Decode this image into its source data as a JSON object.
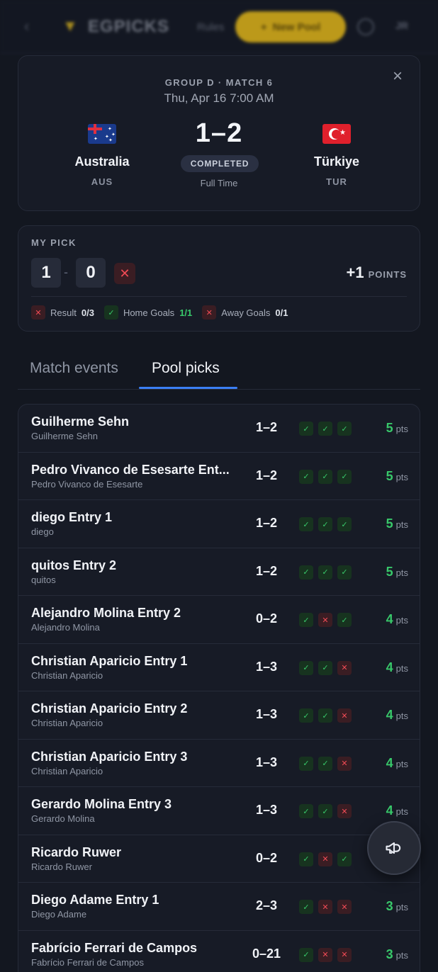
{
  "header": {
    "brand": "EGPICKS",
    "nav_text": "Rules",
    "cta_label": "New Pool",
    "avatar": "JR"
  },
  "match": {
    "meta": "GROUP D · MATCH 6",
    "date": "Thu, Apr 16 7:00 AM",
    "home": {
      "name": "Australia",
      "code": "AUS"
    },
    "away": {
      "name": "Türkiye",
      "code": "TUR"
    },
    "score": "1–2",
    "status": "COMPLETED",
    "status_sub": "Full Time"
  },
  "my_pick": {
    "label": "MY PICK",
    "home": "1",
    "dash": "-",
    "away": "0",
    "result_icon": "✕",
    "points_value": "+1",
    "points_unit": "POINTS",
    "breakdown": [
      {
        "label": "Result",
        "value": "0/3",
        "ok": false
      },
      {
        "label": "Home Goals",
        "value": "1/1",
        "ok": true
      },
      {
        "label": "Away Goals",
        "value": "0/1",
        "ok": false
      }
    ]
  },
  "tabs": [
    {
      "label": "Match events",
      "active": false
    },
    {
      "label": "Pool picks",
      "active": true
    }
  ],
  "pool": {
    "pts_unit": "pts",
    "rows": [
      {
        "name": "Guilherme Sehn",
        "user": "Guilherme Sehn",
        "score": "1–2",
        "checks": [
          true,
          true,
          true
        ],
        "pts": "5"
      },
      {
        "name": "Pedro Vivanco de Esesarte Ent...",
        "user": "Pedro Vivanco de Esesarte",
        "score": "1–2",
        "checks": [
          true,
          true,
          true
        ],
        "pts": "5"
      },
      {
        "name": "diego Entry 1",
        "user": "diego",
        "score": "1–2",
        "checks": [
          true,
          true,
          true
        ],
        "pts": "5"
      },
      {
        "name": "quitos Entry 2",
        "user": "quitos",
        "score": "1–2",
        "checks": [
          true,
          true,
          true
        ],
        "pts": "5"
      },
      {
        "name": "Alejandro Molina Entry 2",
        "user": "Alejandro Molina",
        "score": "0–2",
        "checks": [
          true,
          false,
          true
        ],
        "pts": "4"
      },
      {
        "name": "Christian Aparicio Entry 1",
        "user": "Christian Aparicio",
        "score": "1–3",
        "checks": [
          true,
          true,
          false
        ],
        "pts": "4"
      },
      {
        "name": "Christian Aparicio Entry 2",
        "user": "Christian Aparicio",
        "score": "1–3",
        "checks": [
          true,
          true,
          false
        ],
        "pts": "4"
      },
      {
        "name": "Christian Aparicio Entry 3",
        "user": "Christian Aparicio",
        "score": "1–3",
        "checks": [
          true,
          true,
          false
        ],
        "pts": "4"
      },
      {
        "name": "Gerardo Molina Entry 3",
        "user": "Gerardo Molina",
        "score": "1–3",
        "checks": [
          true,
          true,
          false
        ],
        "pts": "4"
      },
      {
        "name": "Ricardo Ruwer",
        "user": "Ricardo Ruwer",
        "score": "0–2",
        "checks": [
          true,
          false,
          true
        ],
        "pts": ""
      },
      {
        "name": "Diego Adame Entry 1",
        "user": "Diego Adame",
        "score": "2–3",
        "checks": [
          true,
          false,
          false
        ],
        "pts": "3"
      },
      {
        "name": "Fabrício Ferrari de Campos",
        "user": "Fabrício Ferrari de Campos",
        "score": "0–21",
        "checks": [
          true,
          false,
          false
        ],
        "pts": "3"
      }
    ]
  },
  "fab": {
    "icon": "megaphone-icon"
  },
  "colors": {
    "accent": "#3b7ff5",
    "success": "#38c86a",
    "danger": "#f04b55",
    "cta": "#f5c518"
  }
}
